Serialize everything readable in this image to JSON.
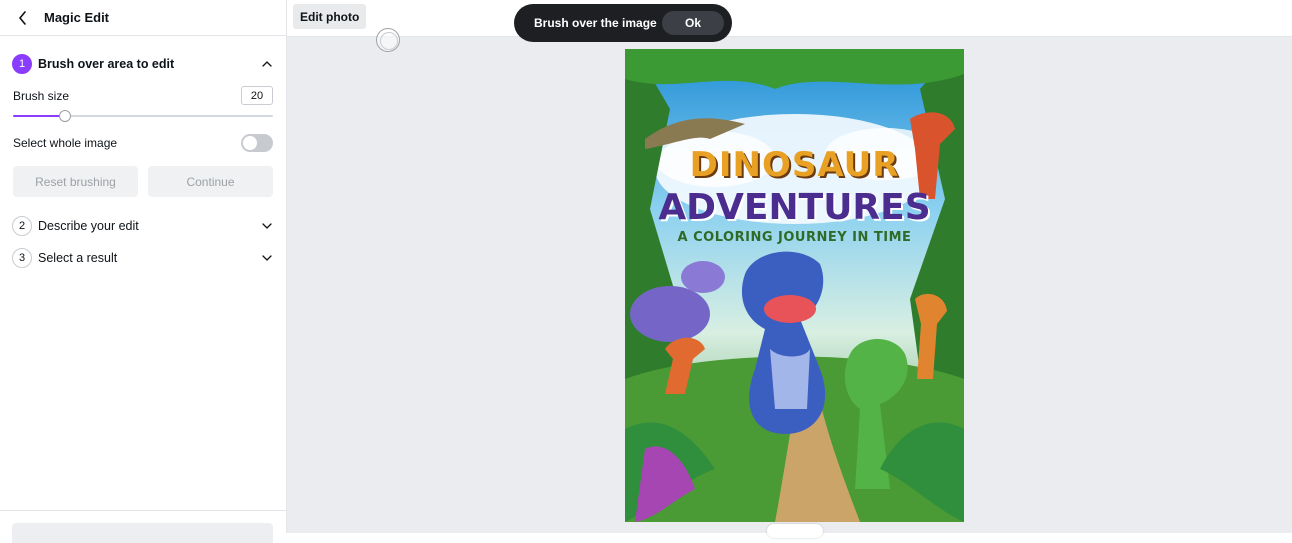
{
  "panel": {
    "title": "Magic Edit",
    "step1": {
      "number": "1",
      "label": "Brush over area to edit"
    },
    "brush_size_label": "Brush size",
    "brush_size_value": "20",
    "brush_size_fraction": 0.2,
    "select_whole_label": "Select whole image",
    "select_whole_on": false,
    "reset_label": "Reset brushing",
    "continue_label": "Continue",
    "step2": {
      "number": "2",
      "label": "Describe your edit"
    },
    "step3": {
      "number": "3",
      "label": "Select a result"
    }
  },
  "topbar": {
    "edit_photo_label": "Edit photo"
  },
  "toast": {
    "text": "Brush over the image",
    "ok_label": "Ok"
  },
  "image": {
    "title_line1": "DINOSAUR",
    "title_line2": "ADVENTURES",
    "subtitle": "A COLORING JOURNEY IN TIME"
  },
  "colors": {
    "accent": "#8b3dff",
    "toast_bg": "#1d1f23"
  }
}
